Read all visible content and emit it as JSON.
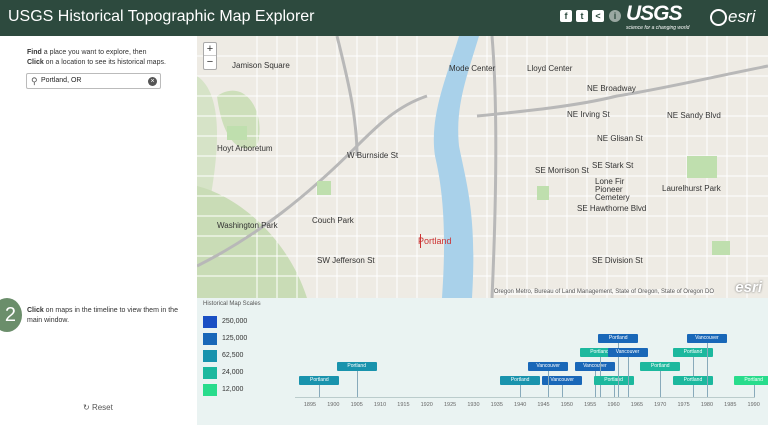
{
  "header": {
    "title": "USGS Historical Topographic Map Explorer",
    "share_icons": [
      "facebook-icon",
      "twitter-icon",
      "share-icon"
    ],
    "info_icon": "i",
    "usgs_logo": "USGS",
    "usgs_tagline": "science for a changing world",
    "esri_logo": "esri"
  },
  "left_panel": {
    "step1_bold1": "Find",
    "step1_text1": " a place you want to explore, then ",
    "step1_bold2": "Click",
    "step1_text2": " on a location to see its historical maps.",
    "search_value": "Portland, OR",
    "step2_number": "2",
    "step2_bold": "Click",
    "step2_text": " on maps in the timeline to view them in the main window.",
    "reset_label": "Reset"
  },
  "map": {
    "zoom_in": "+",
    "zoom_out": "−",
    "city_label": "Portland",
    "attribution": "Oregon Metro, Bureau of Land Management, State of Oregon, State of Oregon DO",
    "watermark": "esri",
    "labels": [
      "Mode Center",
      "NE Broadway",
      "NE Irving St",
      "NE Glisan St",
      "SE Stark St",
      "SE Morrison St",
      "SE Hawthorne Blvd",
      "SE Division St",
      "W Burnside St",
      "Lone Fir Pioneer Cemetery",
      "Laurelhurst Park",
      "Washington Park",
      "Lloyd Center",
      "Couch Park",
      "Hoyt Arboretum",
      "Jamison Square",
      "NE Sandy Blvd",
      "SW Jefferson St"
    ]
  },
  "timeline": {
    "title": "Historical Map Scales",
    "scales": [
      {
        "label": "250,000",
        "color": "#1a4fc4"
      },
      {
        "label": "125,000",
        "color": "#1967b8"
      },
      {
        "label": "62,500",
        "color": "#1993ad"
      },
      {
        "label": "24,000",
        "color": "#1cb89e"
      },
      {
        "label": "12,000",
        "color": "#28dc8c"
      }
    ],
    "years": [
      "1895",
      "1900",
      "1905",
      "1910",
      "1915",
      "1920",
      "1925",
      "1930",
      "1935",
      "1940",
      "1945",
      "1950",
      "1955",
      "1960",
      "1965",
      "1970",
      "1975",
      "1980",
      "1985",
      "1990"
    ],
    "maps": [
      {
        "label": "Portland",
        "year": 1897,
        "scale": 2,
        "row": 0
      },
      {
        "label": "Portland",
        "year": 1905,
        "scale": 2,
        "row": 1
      },
      {
        "label": "Portland",
        "year": 1940,
        "scale": 2,
        "row": 0
      },
      {
        "label": "Vancouver",
        "year": 1949,
        "scale": 1,
        "row": 0
      },
      {
        "label": "Vancouver",
        "year": 1946,
        "scale": 1,
        "row": 1
      },
      {
        "label": "Vancouver",
        "year": 1956,
        "scale": 1,
        "row": 1
      },
      {
        "label": "Portland",
        "year": 1957,
        "scale": 3,
        "row": 2
      },
      {
        "label": "Portland",
        "year": 1960,
        "scale": 3,
        "row": 0
      },
      {
        "label": "Portland",
        "year": 1961,
        "scale": 1,
        "row": 3
      },
      {
        "label": "Vancouver",
        "year": 1963,
        "scale": 1,
        "row": 2
      },
      {
        "label": "Portland",
        "year": 1970,
        "scale": 3,
        "row": 1
      },
      {
        "label": "Portland",
        "year": 1977,
        "scale": 3,
        "row": 2
      },
      {
        "label": "Portland",
        "year": 1977,
        "scale": 3,
        "row": 0
      },
      {
        "label": "Vancouver",
        "year": 1980,
        "scale": 1,
        "row": 3
      },
      {
        "label": "Portland",
        "year": 1990,
        "scale": 4,
        "row": 0
      }
    ]
  }
}
